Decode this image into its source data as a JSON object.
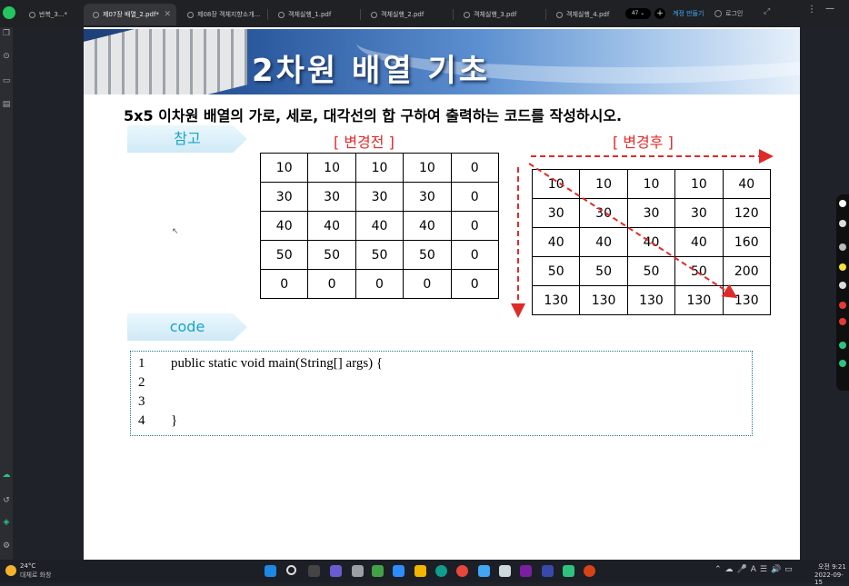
{
  "browser": {
    "tabs": [
      {
        "label": "반복_3...*",
        "active": false
      },
      {
        "label": "제07장 배열_2.pdf*",
        "active": true
      },
      {
        "label": "제08장 객체지향소개...",
        "active": false
      },
      {
        "label": "객체실행_1.pdf",
        "active": false
      },
      {
        "label": "객체실행_2.pdf",
        "active": false
      },
      {
        "label": "객체실행_3.pdf",
        "active": false
      },
      {
        "label": "객체실행_4.pdf",
        "active": false
      }
    ],
    "tab_count": "47",
    "make_button": "계정 만들기",
    "login_button": "로그인"
  },
  "slide": {
    "title": "2차원 배열 기초",
    "instruction": "5x5 이차원 배열의 가로, 세로, 대각선의 합 구하여 출력하는 코드를 작성하시오.",
    "ref_tag": "참고",
    "code_tag": "code",
    "caption_before": "[ 변경전 ]",
    "caption_after": "[ 변경후 ]",
    "grid_before": [
      [
        "10",
        "10",
        "10",
        "10",
        "0"
      ],
      [
        "30",
        "30",
        "30",
        "30",
        "0"
      ],
      [
        "40",
        "40",
        "40",
        "40",
        "0"
      ],
      [
        "50",
        "50",
        "50",
        "50",
        "0"
      ],
      [
        "0",
        "0",
        "0",
        "0",
        "0"
      ]
    ],
    "grid_after": [
      [
        "10",
        "10",
        "10",
        "10",
        "40"
      ],
      [
        "30",
        "30",
        "30",
        "30",
        "120"
      ],
      [
        "40",
        "40",
        "40",
        "40",
        "160"
      ],
      [
        "50",
        "50",
        "50",
        "50",
        "200"
      ],
      [
        "130",
        "130",
        "130",
        "130",
        "130"
      ]
    ],
    "code_lines": [
      {
        "num": "1",
        "text": "    public static void main(String[] args) {"
      },
      {
        "num": "2",
        "text": ""
      },
      {
        "num": "3",
        "text": ""
      },
      {
        "num": "4",
        "text": "    }"
      }
    ]
  },
  "taskbar": {
    "weather_temp": "24°C",
    "weather_desc": "대체로 화창",
    "clock_time": "오전 9:21",
    "clock_date": "2022-09-15"
  },
  "colors": {
    "accent_red": "#e02a2a",
    "tag_text": "#1aa3c8",
    "browser_link": "#3fa9ff"
  }
}
